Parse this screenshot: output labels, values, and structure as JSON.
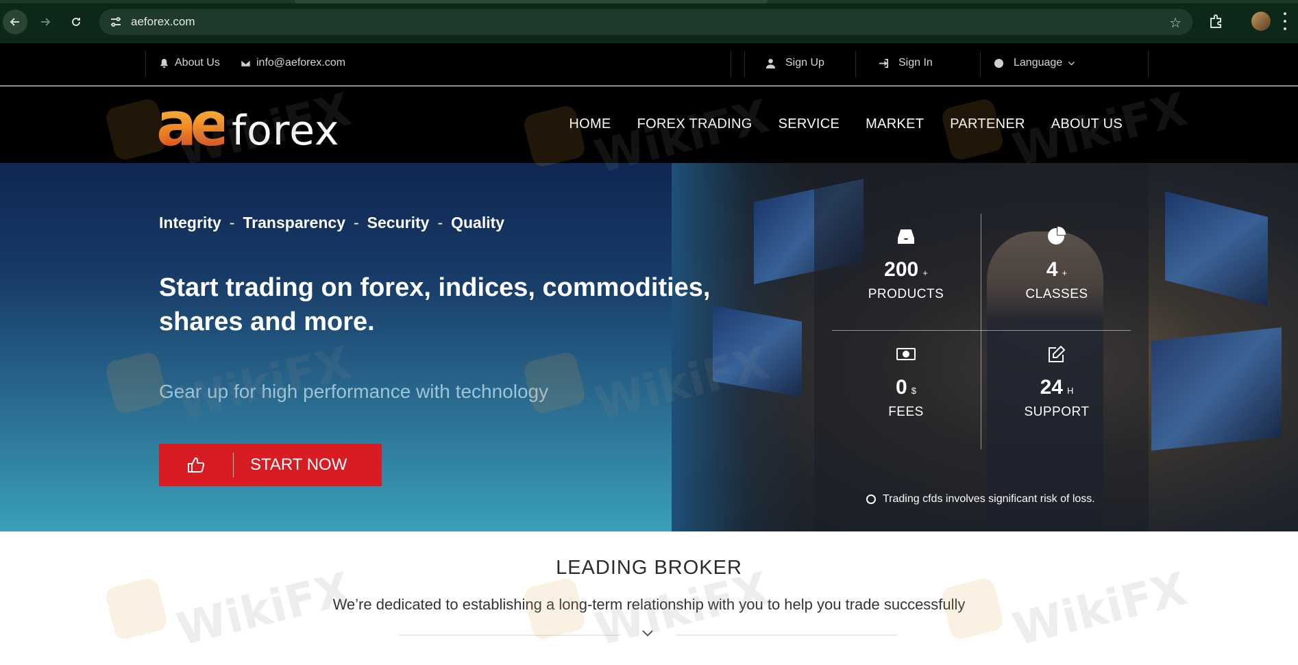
{
  "browser": {
    "url": "aeforex.com"
  },
  "topbar": {
    "about_label": "About Us",
    "email_label": "info@aeforex.com",
    "signup_label": "Sign Up",
    "signin_label": "Sign In",
    "language_label": "Language"
  },
  "header": {
    "logo_mark": "ae",
    "logo_text": "forex",
    "nav": [
      "HOME",
      "FOREX TRADING",
      "SERVICE",
      "MARKET",
      "PARTENER",
      "ABOUT US"
    ]
  },
  "hero": {
    "tagline": [
      "Integrity",
      "Transparency",
      "Security",
      "Quality"
    ],
    "tagline_sep": "-",
    "headline": "Start trading on forex, indices, commodities, shares and more.",
    "subhead": "Gear up for high performance with technology",
    "cta_label": "START NOW",
    "stats": [
      {
        "icon": "inbox-icon",
        "value": "200",
        "unit": "+",
        "caption": "PRODUCTS"
      },
      {
        "icon": "pie-chart-icon",
        "value": "4",
        "unit": "+",
        "caption": "CLASSES"
      },
      {
        "icon": "money-icon",
        "value": "0",
        "unit": "$",
        "caption": "FEES"
      },
      {
        "icon": "edit-icon",
        "value": "24",
        "unit": "H",
        "caption": "SUPPORT"
      }
    ],
    "risk_note": "Trading cfds involves significant risk of loss."
  },
  "section": {
    "title": "LEADING BROKER",
    "text": "We’re dedicated to establishing a long-term relationship with you to help you trade successfully"
  },
  "watermark": {
    "text": "WikiFX"
  },
  "colors": {
    "cta": "#d71c24",
    "chrome": "#0d2718",
    "topbar": "#000000"
  }
}
